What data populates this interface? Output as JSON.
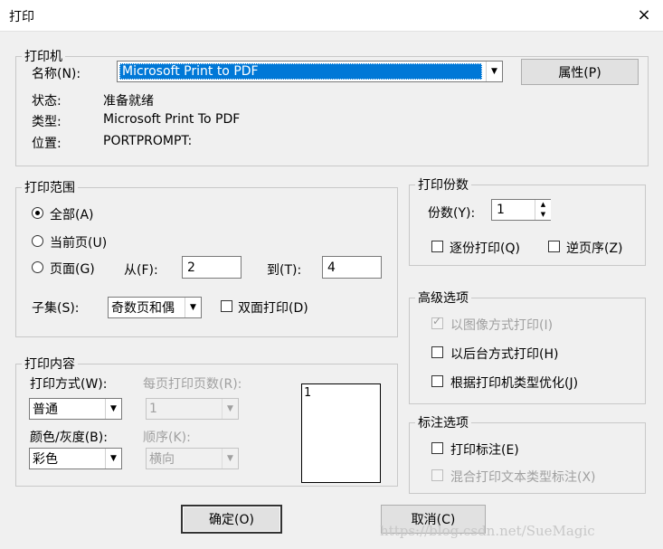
{
  "window": {
    "title": "打印",
    "close_icon": "×"
  },
  "printer": {
    "legend": "打印机",
    "name_label": "名称(N):",
    "name_value": "Microsoft Print to PDF",
    "properties_button": "属性(P)",
    "status_label": "状态:",
    "status_value": "准备就绪",
    "type_label": "类型:",
    "type_value": "Microsoft Print To PDF",
    "location_label": "位置:",
    "location_value": "PORTPROMPT:"
  },
  "range": {
    "legend": "打印范围",
    "all_label": "全部(A)",
    "current_label": "当前页(U)",
    "pages_label": "页面(G)",
    "from_label": "从(F):",
    "from_value": "2",
    "to_label": "到(T):",
    "to_value": "4",
    "subset_label": "子集(S):",
    "subset_value": "奇数页和偶",
    "duplex_label": "双面打印(D)"
  },
  "copies": {
    "legend": "打印份数",
    "count_label": "份数(Y):",
    "count_value": "1",
    "collate_label": "逐份打印(Q)",
    "reverse_label": "逆页序(Z)"
  },
  "advanced": {
    "legend": "高级选项",
    "image_label": "以图像方式打印(I)",
    "background_label": "以后台方式打印(H)",
    "optimize_label": "根据打印机类型优化(J)"
  },
  "markup": {
    "legend": "标注选项",
    "print_markup_label": "打印标注(E)",
    "mixed_label": "混合打印文本类型标注(X)"
  },
  "content": {
    "legend": "打印内容",
    "mode_label": "打印方式(W):",
    "mode_value": "普通",
    "per_page_label": "每页打印页数(R):",
    "per_page_value": "1",
    "color_label": "颜色/灰度(B):",
    "color_value": "彩色",
    "order_label": "顺序(K):",
    "order_value": "横向",
    "preview_text": "1"
  },
  "buttons": {
    "ok": "确定(O)",
    "cancel": "取消(C)"
  },
  "watermark": "https://blog.csdn.net/SueMagic",
  "colors": {
    "selection": "#0078d7",
    "background": "#f0f0f0"
  }
}
